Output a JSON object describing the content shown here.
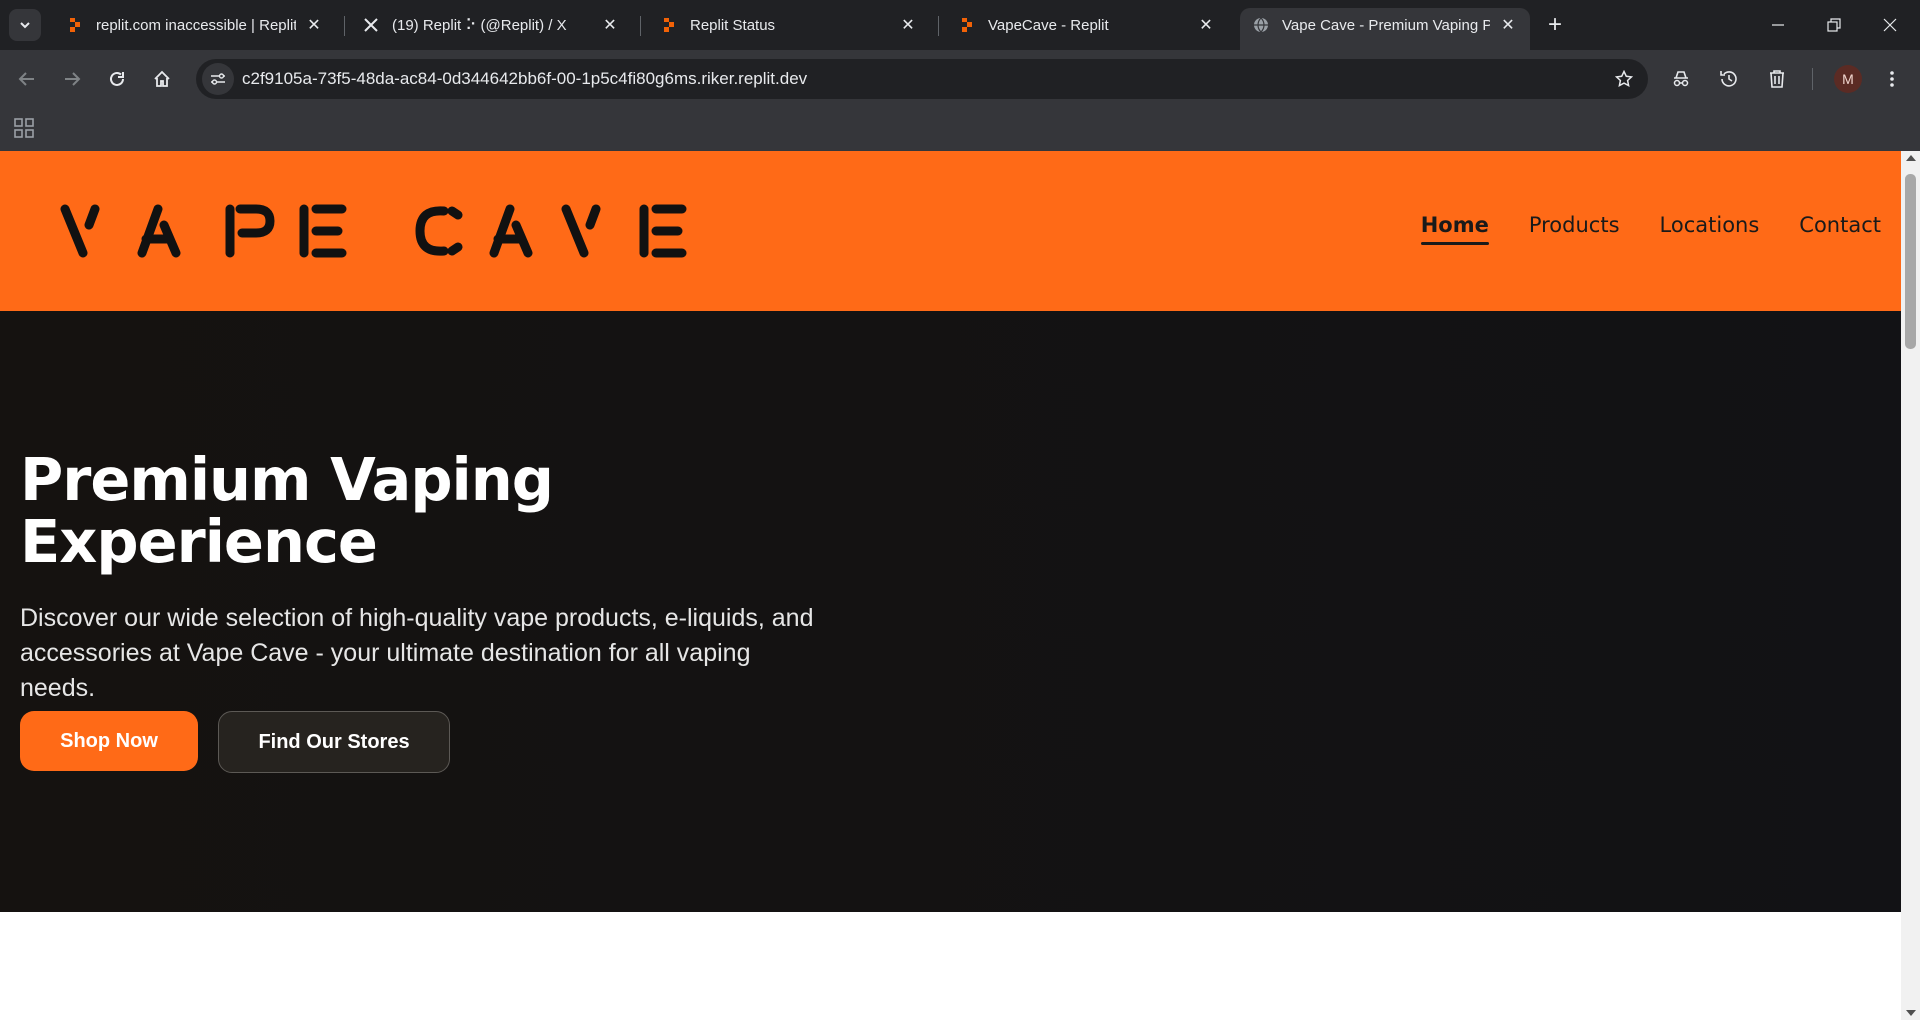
{
  "browser": {
    "tabs": [
      {
        "title": "replit.com inaccessible | Replit S",
        "favicon": "replit-icon",
        "active": false
      },
      {
        "title": "(19) Replit ⠕ (@Replit) / X",
        "favicon": "x-icon",
        "active": false
      },
      {
        "title": "Replit Status",
        "favicon": "replit-icon",
        "active": false
      },
      {
        "title": "VapeCave - Replit",
        "favicon": "replit-icon",
        "active": false
      },
      {
        "title": "Vape Cave - Premium Vaping Pr",
        "favicon": "globe-icon",
        "active": true
      }
    ],
    "url": "c2f9105a-73f5-48da-ac84-0d344642bb6f-00-1p5c4fi80g6ms.riker.replit.dev",
    "profile_initial": "M"
  },
  "site": {
    "logo_text": "VAPE CAVE",
    "nav": [
      {
        "label": "Home",
        "active": true
      },
      {
        "label": "Products",
        "active": false
      },
      {
        "label": "Locations",
        "active": false
      },
      {
        "label": "Contact",
        "active": false
      }
    ],
    "hero": {
      "title_line1": "Premium Vaping",
      "title_line2": "Experience",
      "description": "Discover our wide selection of high-quality vape products, e-liquids, and accessories at Vape Cave - your ultimate destination for all vaping needs.",
      "primary_button": "Shop Now",
      "secondary_button": "Find Our Stores"
    }
  },
  "colors": {
    "brand_orange": "#ff6a17",
    "hero_bg": "#131214",
    "chrome_dark": "#202124",
    "chrome_toolbar": "#35363a"
  }
}
